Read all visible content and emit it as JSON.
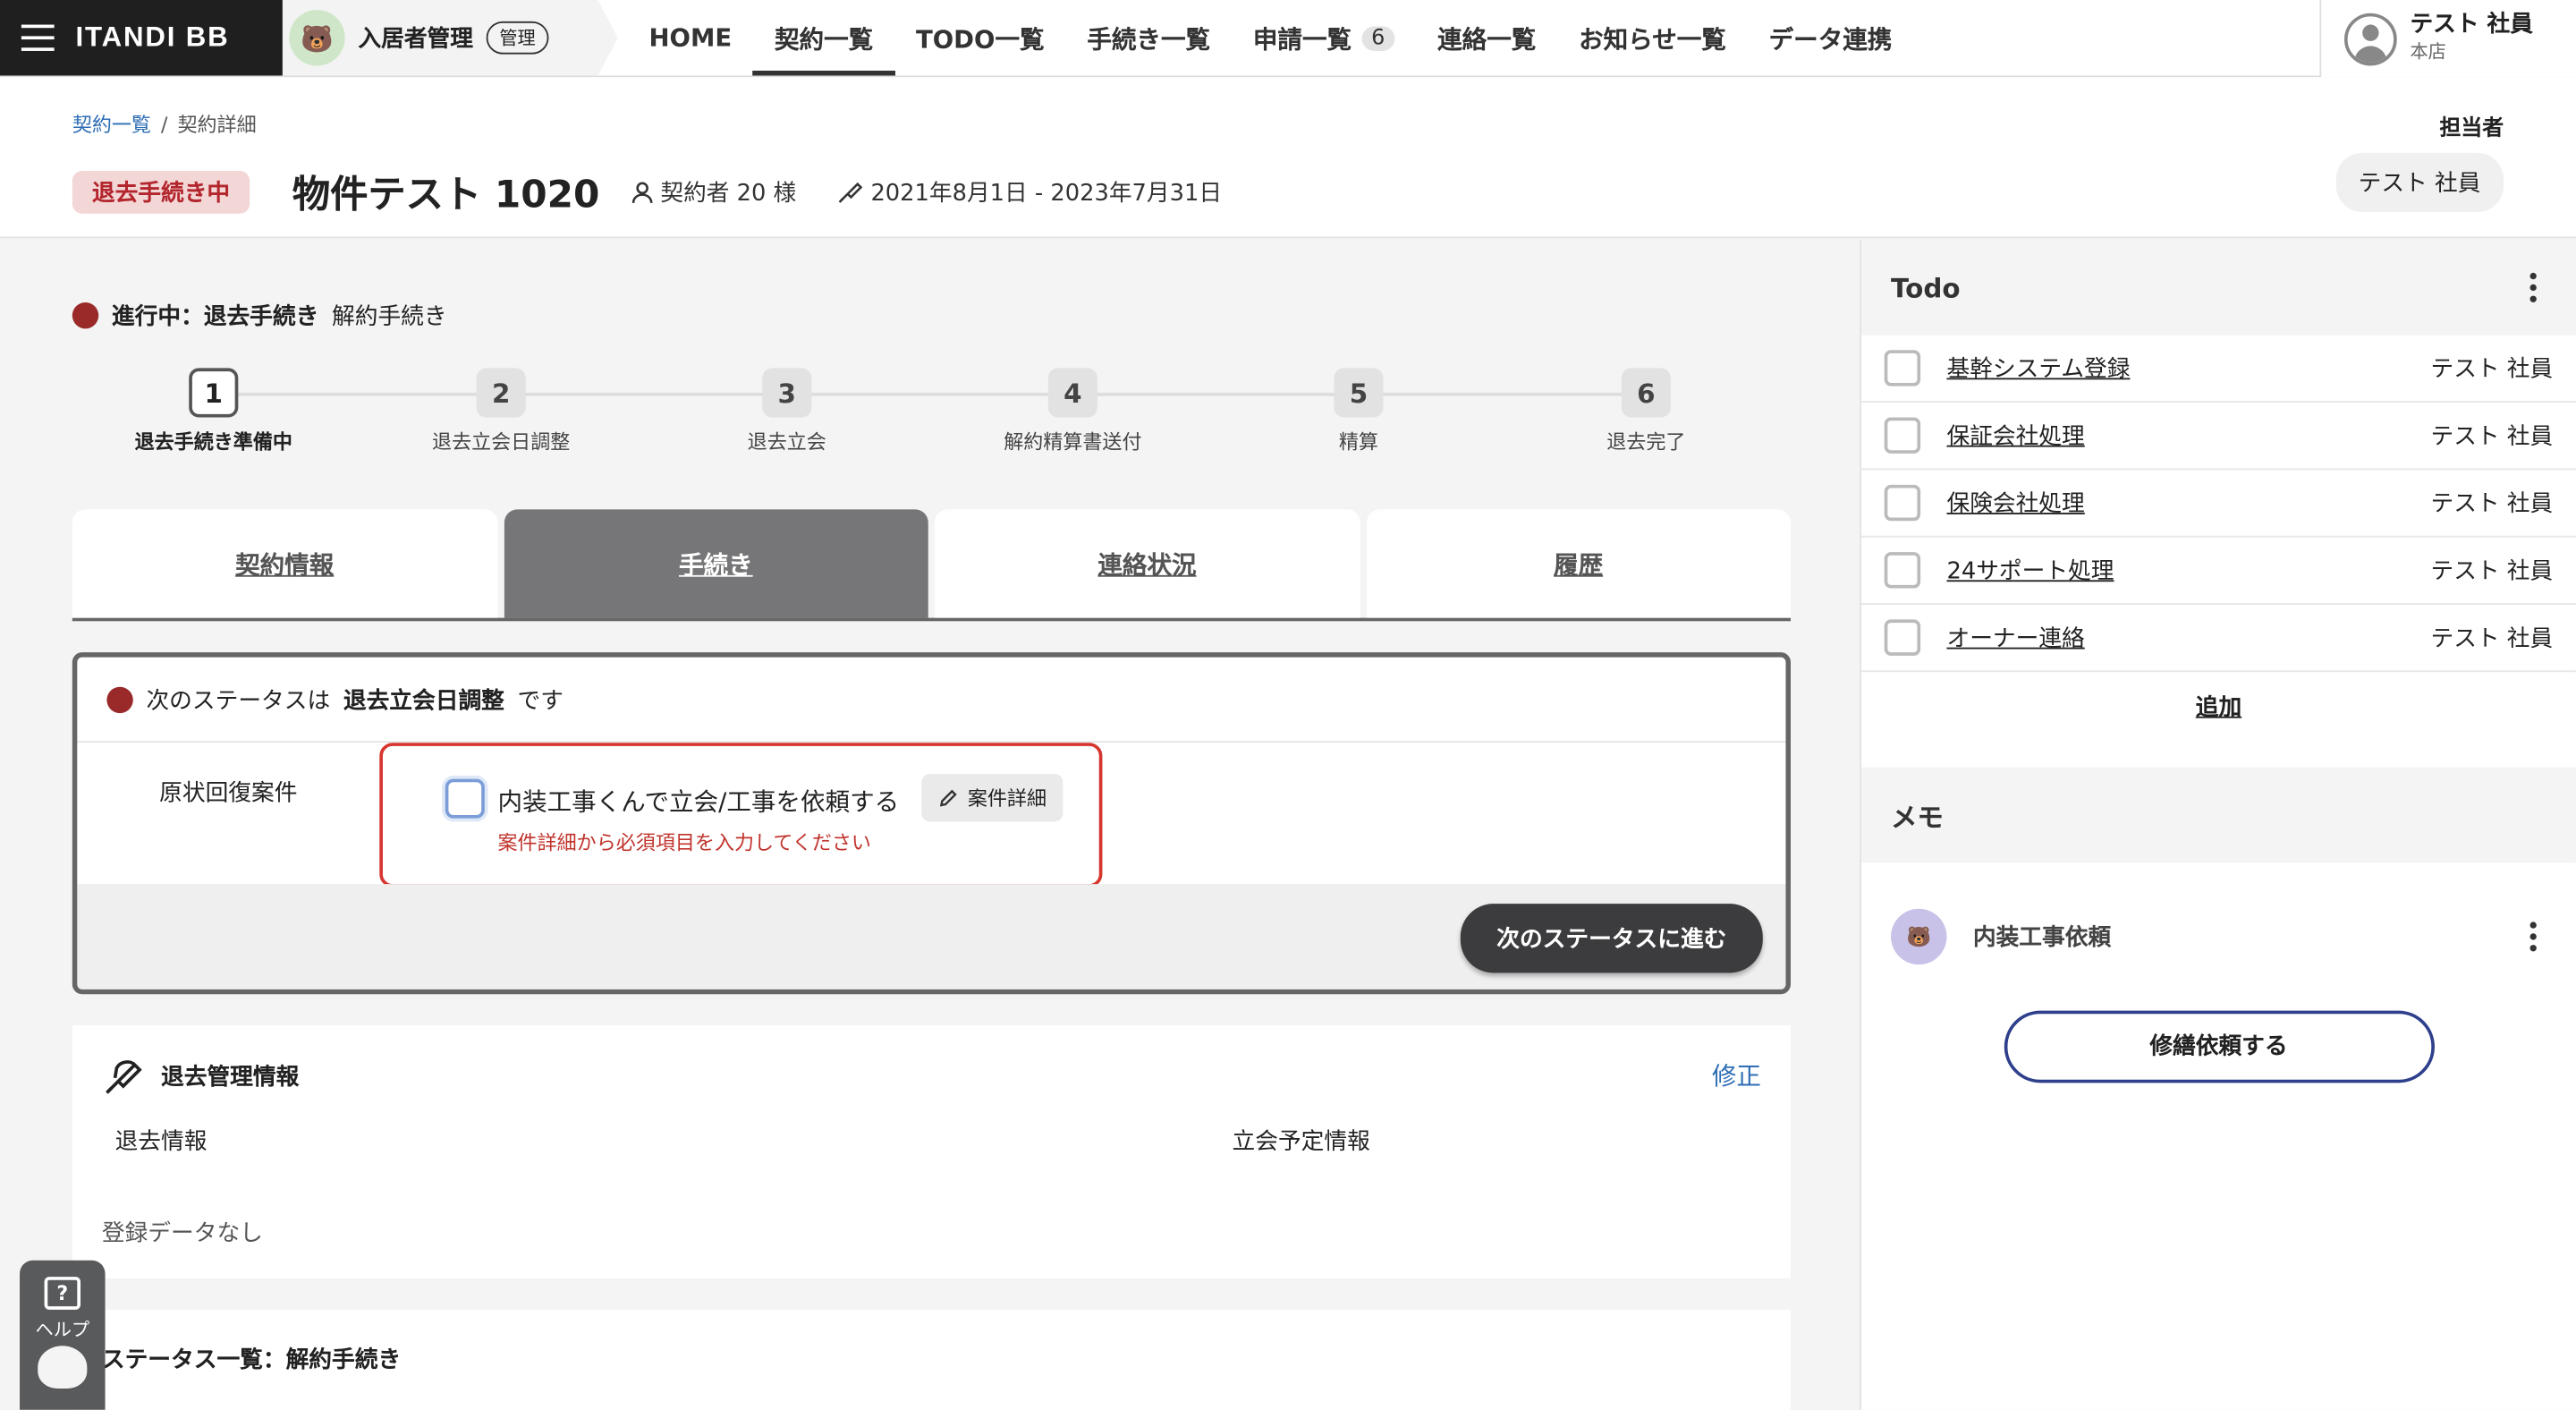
{
  "nav": {
    "brand": "ITANDI BB",
    "app_title": "入居者管理",
    "app_badge": "管理",
    "menu": [
      {
        "label": "HOME",
        "active": false
      },
      {
        "label": "契約一覧",
        "active": true
      },
      {
        "label": "TODO一覧",
        "active": false
      },
      {
        "label": "手続き一覧",
        "active": false
      },
      {
        "label": "申請一覧",
        "active": false,
        "count": "6"
      },
      {
        "label": "連絡一覧",
        "active": false
      },
      {
        "label": "お知らせ一覧",
        "active": false
      },
      {
        "label": "データ連携",
        "active": false
      }
    ],
    "user_name": "テスト 社員",
    "user_branch": "本店"
  },
  "header": {
    "breadcrumb_link": "契約一覧",
    "breadcrumb_sep": "/",
    "breadcrumb_current": "契約詳細",
    "status_tag": "退去手続き中",
    "property_title": "物件テスト 1020",
    "contractor_count": "契約者 20 様",
    "contract_period": "2021年8月1日 - 2023年7月31日",
    "assignee_label": "担当者",
    "assignee_name": "テスト 社員"
  },
  "progress": {
    "prefix": "進行中：退去手続き",
    "suffix": "解約手続き",
    "steps": [
      {
        "num": "1",
        "label": "退去手続き準備中",
        "current": true
      },
      {
        "num": "2",
        "label": "退去立会日調整",
        "current": false
      },
      {
        "num": "3",
        "label": "退去立会",
        "current": false
      },
      {
        "num": "4",
        "label": "解約精算書送付",
        "current": false
      },
      {
        "num": "5",
        "label": "精算",
        "current": false
      },
      {
        "num": "6",
        "label": "退去完了",
        "current": false
      }
    ]
  },
  "tabs": [
    {
      "label": "契約情報",
      "active": false
    },
    {
      "label": "手続き",
      "active": true
    },
    {
      "label": "連絡状況",
      "active": false
    },
    {
      "label": "履歴",
      "active": false
    }
  ],
  "next_panel": {
    "text_before": "次のステータスは",
    "next_status": "退去立会日調整",
    "text_after": "です",
    "row_label": "原状回復案件",
    "task_text": "内装工事くんで立会/工事を依頼する",
    "detail_button": "案件詳細",
    "error_text": "案件詳細から必須項目を入力してください",
    "next_button": "次のステータスに進む"
  },
  "retire_card": {
    "title": "退去管理情報",
    "edit": "修正",
    "col1": "退去情報",
    "col2": "立会予定情報",
    "empty": "登録データなし"
  },
  "status_card": {
    "title": "ステータス一覧：解約手続き"
  },
  "help": {
    "label": "ヘルプ"
  },
  "todo": {
    "title": "Todo",
    "items": [
      {
        "name": "基幹システム登録",
        "owner": "テスト 社員"
      },
      {
        "name": "保証会社処理",
        "owner": "テスト 社員"
      },
      {
        "name": "保険会社処理",
        "owner": "テスト 社員"
      },
      {
        "name": "24サポート処理",
        "owner": "テスト 社員"
      },
      {
        "name": "オーナー連絡",
        "owner": "テスト 社員"
      }
    ],
    "add": "追加"
  },
  "memo": {
    "title": "メモ",
    "item_title": "内装工事依頼",
    "repair_button": "修繕依頼する"
  }
}
